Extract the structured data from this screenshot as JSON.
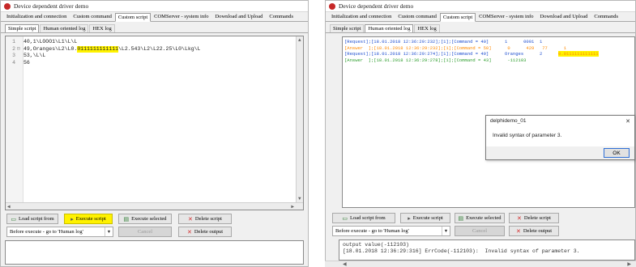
{
  "left": {
    "title": "Device dependent driver demo",
    "menu": [
      "Initialization and connection",
      "Custom command",
      "Custom script",
      "COMServer - system info",
      "Download and Upload",
      "Commands"
    ],
    "subtabs": [
      "Simple script",
      "Human oriented log",
      "HEX log"
    ],
    "lines": [
      {
        "n": "1",
        "fold": "",
        "pre": "40,1\\LOOO1\\L1\\L\\L",
        "hl": "",
        "post": ""
      },
      {
        "n": "2",
        "fold": "⊟",
        "pre": "49,Oranges\\L2\\L0.",
        "hl": "0111111111111",
        "post": "\\L2.543\\L2\\L22.25\\L0\\Lkg\\L"
      },
      {
        "n": "3",
        "fold": "",
        "pre": "53,\\L\\L",
        "hl": "",
        "post": ""
      },
      {
        "n": "4",
        "fold": "",
        "pre": "56",
        "hl": "",
        "post": ""
      }
    ],
    "buttons": {
      "load": "Load script from",
      "execute": "Execute script",
      "execute_selected": "Execute selected",
      "delete_script": "Delete script",
      "before_execute": "Before execute - go to 'Human log'",
      "cancel": "Cancel",
      "delete_output": "Delete output"
    }
  },
  "right": {
    "title": "Device dependent driver demo",
    "menu": [
      "Initialization and connection",
      "Custom command",
      "Custom script",
      "COMServer - system info",
      "Download and Upload",
      "Commands"
    ],
    "subtabs": [
      "Simple script",
      "Human oriented log",
      "HEX log"
    ],
    "log": [
      {
        "cls": "c-blue",
        "text": "[Request];[18.01.2018 12:36:29:232];[1];[Command = 40]      1      0001  1",
        "hl": ""
      },
      {
        "cls": "c-orange",
        "text": "[Answer  ];[18.01.2018 12:36:29:232];[1];[Command = 50]      0      429   77      1",
        "hl": ""
      },
      {
        "cls": "c-blue",
        "text": "[Request];[18.01.2018 12:36:29:274];[1];[Command = 49]      Oranges      2      ",
        "hl": "0.0111111111111"
      },
      {
        "cls": "c-green",
        "text": "[Answer  ];[18.01.2018 12:36:29:278];[1];[Command = 43]      -112103",
        "hl": ""
      }
    ],
    "buttons": {
      "load": "Load script from",
      "execute": "Execute script",
      "execute_selected": "Execute selected",
      "delete_script": "Delete script",
      "before_execute": "Before execute - go to 'Human log'",
      "cancel": "Cancel",
      "delete_output": "Delete output"
    },
    "output": [
      "output value(-112103)",
      "[18.01.2018 12:36:29:316] ErrCode(-112103):  Invalid syntax of parameter 3."
    ]
  },
  "dialog": {
    "title": "delphidemo_01",
    "message": "Invalid syntax of parameter 3.",
    "ok": "OK"
  }
}
